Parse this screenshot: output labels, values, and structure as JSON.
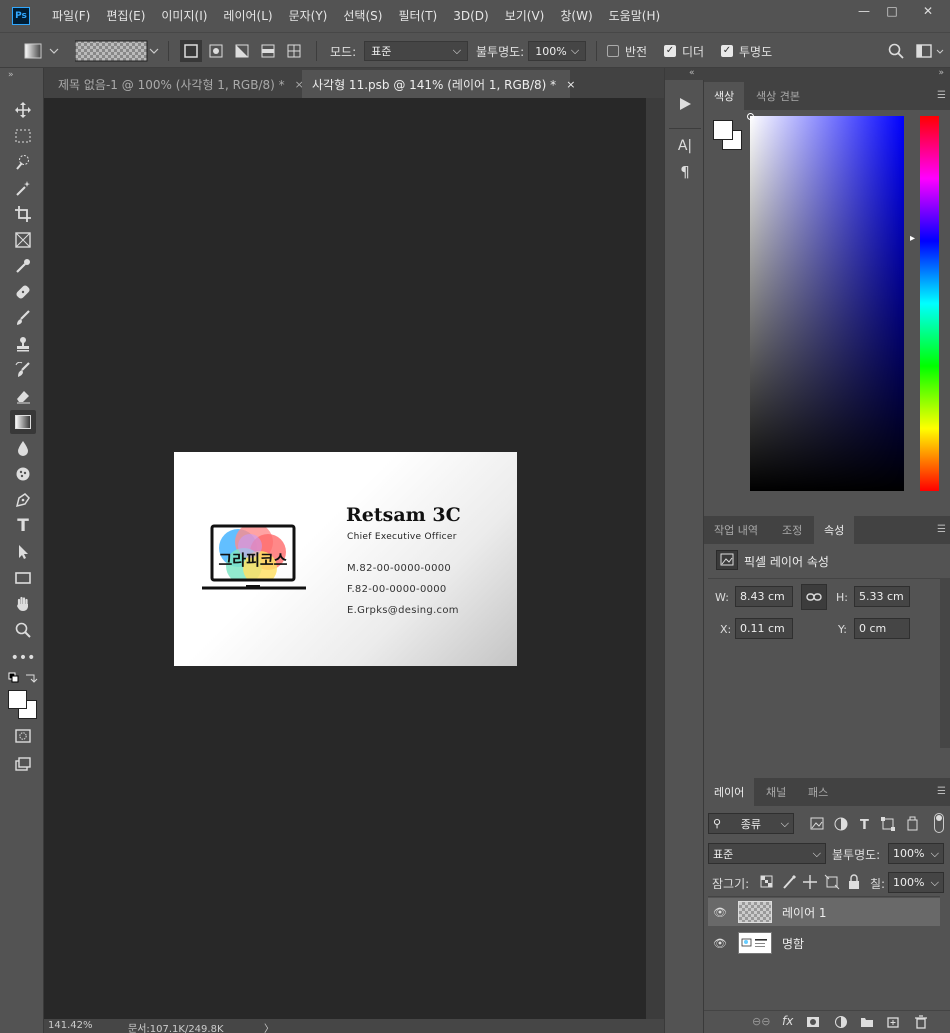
{
  "app": {
    "logo": "Ps"
  },
  "menu": [
    "파일(F)",
    "편집(E)",
    "이미지(I)",
    "레이어(L)",
    "문자(Y)",
    "선택(S)",
    "필터(T)",
    "3D(D)",
    "보기(V)",
    "창(W)",
    "도움말(H)"
  ],
  "window": {
    "minimize": "—",
    "restore": "□",
    "close": "✕"
  },
  "options": {
    "mode_label": "모드:",
    "mode_value": "표준",
    "opacity_label": "불투명도:",
    "opacity_value": "100%",
    "reverse_label": "반전",
    "dither_label": "디더",
    "transparency_label": "투명도"
  },
  "tabs": [
    {
      "label": "제목 없음-1 @ 100% (사각형 1, RGB/8) *",
      "close": "×"
    },
    {
      "label": "사각형 11.psb @ 141% (레이어 1, RGB/8) *",
      "close": "×"
    }
  ],
  "card": {
    "logo_text": "그라피코스",
    "company": "Retsam 3C",
    "title": "Chief Executive Officer",
    "mobile": "M.82-00-0000-0000",
    "fax": "F.82-00-0000-0000",
    "email": "E.Grpks@desing.com"
  },
  "status": {
    "zoom": "141.42%",
    "doc": "문서:107.1K/249.8K",
    "arrow": "〉"
  },
  "color_panel": {
    "tabs": [
      "색상",
      "색상 견본"
    ],
    "hue_colors": [
      "#ff0000",
      "#ff00ff",
      "#0000ff",
      "#00ffff",
      "#00ff00",
      "#ffff00",
      "#ff0000"
    ],
    "field_color": "#0000ff"
  },
  "properties_panel": {
    "tabs": [
      "작업 내역",
      "조정",
      "속성"
    ],
    "heading": "픽셀 레이어 속성",
    "w_label": "W:",
    "w_value": "8.43 cm",
    "h_label": "H:",
    "h_value": "5.33 cm",
    "x_label": "X:",
    "x_value": "0.11 cm",
    "y_label": "Y:",
    "y_value": "0 cm"
  },
  "layers_panel": {
    "tabs": [
      "레이어",
      "채널",
      "패스"
    ],
    "filter_label": "종류",
    "blend_mode": "표준",
    "opacity_label": "불투명도:",
    "opacity_value": "100%",
    "lock_label": "잠그기:",
    "fill_label": "칠:",
    "fill_value": "100%",
    "layers": [
      {
        "name": "레이어 1"
      },
      {
        "name": "명함"
      }
    ],
    "footer_fx": "fx"
  }
}
